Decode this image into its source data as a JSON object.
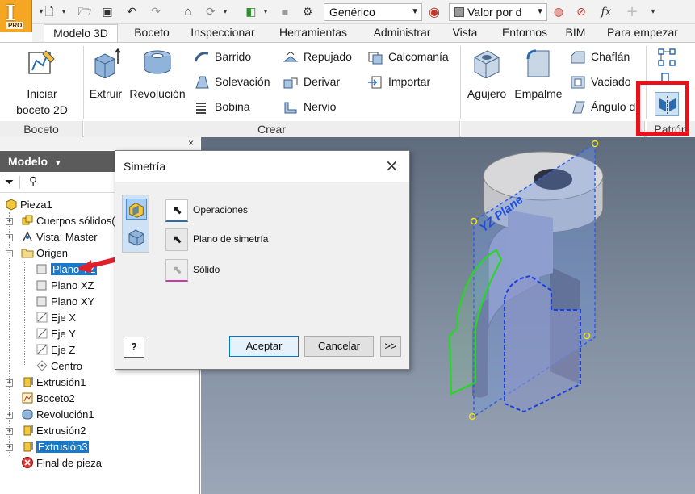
{
  "app": {
    "logo_letter": "I",
    "logo_badge": "PRO"
  },
  "quick_access": {
    "material": "Genérico",
    "appearance": "Valor por d",
    "fx_label": "fx"
  },
  "tabs": [
    {
      "label": "Modelo 3D",
      "active": true
    },
    {
      "label": "Boceto"
    },
    {
      "label": "Inspeccionar"
    },
    {
      "label": "Herramientas"
    },
    {
      "label": "Administrar"
    },
    {
      "label": "Vista"
    },
    {
      "label": "Entornos"
    },
    {
      "label": "BIM"
    },
    {
      "label": "Para empezar"
    }
  ],
  "ribbon": {
    "sketch": {
      "button_line1": "Iniciar",
      "button_line2": "boceto 2D",
      "panel": "Boceto"
    },
    "create": {
      "panel": "Crear",
      "extrude": "Extruir",
      "revolve": "Revolución",
      "sweep": "Barrido",
      "loft": "Solevación",
      "coil": "Bobina",
      "emboss": "Repujado",
      "derive": "Derivar",
      "rib": "Nervio",
      "decal": "Calcomanía",
      "import": "Importar"
    },
    "modify": {
      "hole": "Agujero",
      "fillet": "Empalme",
      "chamfer": "Chaflán",
      "shell": "Vaciado",
      "draft": "Ángulo d"
    },
    "pattern": {
      "panel": "Patrón"
    },
    "highlight_color": "#e8101a"
  },
  "browser": {
    "title": "Modelo",
    "close": "×",
    "items": [
      {
        "label": "Pieza1"
      },
      {
        "label": "Cuerpos sólidos("
      },
      {
        "label": "Vista: Master"
      },
      {
        "label": "Origen"
      },
      {
        "label": "Plano YZ"
      },
      {
        "label": "Plano XZ"
      },
      {
        "label": "Plano XY"
      },
      {
        "label": "Eje X"
      },
      {
        "label": "Eje Y"
      },
      {
        "label": "Eje Z"
      },
      {
        "label": "Centro"
      },
      {
        "label": "Extrusión1"
      },
      {
        "label": "Boceto2"
      },
      {
        "label": "Revolución1"
      },
      {
        "label": "Extrusión2"
      },
      {
        "label": "Extrusión3"
      },
      {
        "label": "Final de pieza"
      }
    ],
    "selection_color": "#1979ca"
  },
  "dialog": {
    "title": "Simetría",
    "close": "×",
    "operations": "Operaciones",
    "mirror_plane": "Plano de simetría",
    "solid": "Sólido",
    "help": "?",
    "ok": "Aceptar",
    "cancel": "Cancelar",
    "more": ">>"
  },
  "viewport": {
    "plane_label": "YZ Plane"
  },
  "arrow_color": "#e0202a"
}
